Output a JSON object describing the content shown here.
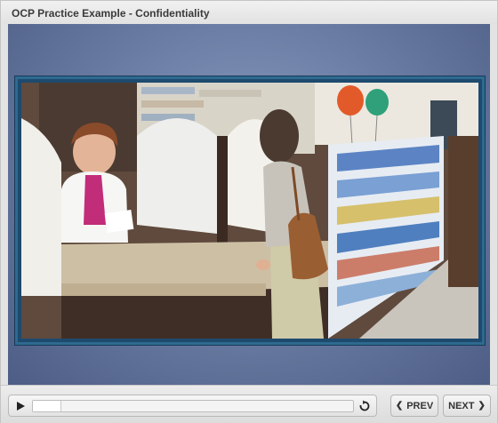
{
  "window": {
    "title": "OCP Practice Example - Confidentiality"
  },
  "player": {
    "progress": 0.09,
    "play_icon": "play-icon",
    "replay_icon": "replay-icon"
  },
  "nav": {
    "prev_label": "PREV",
    "next_label": "NEXT",
    "prev_icon": "chevron-left-icon",
    "next_icon": "chevron-right-icon"
  },
  "colors": {
    "stage": "#6d7fa6",
    "video_border": "#2f6a8f",
    "chrome": "#e3e3e3"
  }
}
